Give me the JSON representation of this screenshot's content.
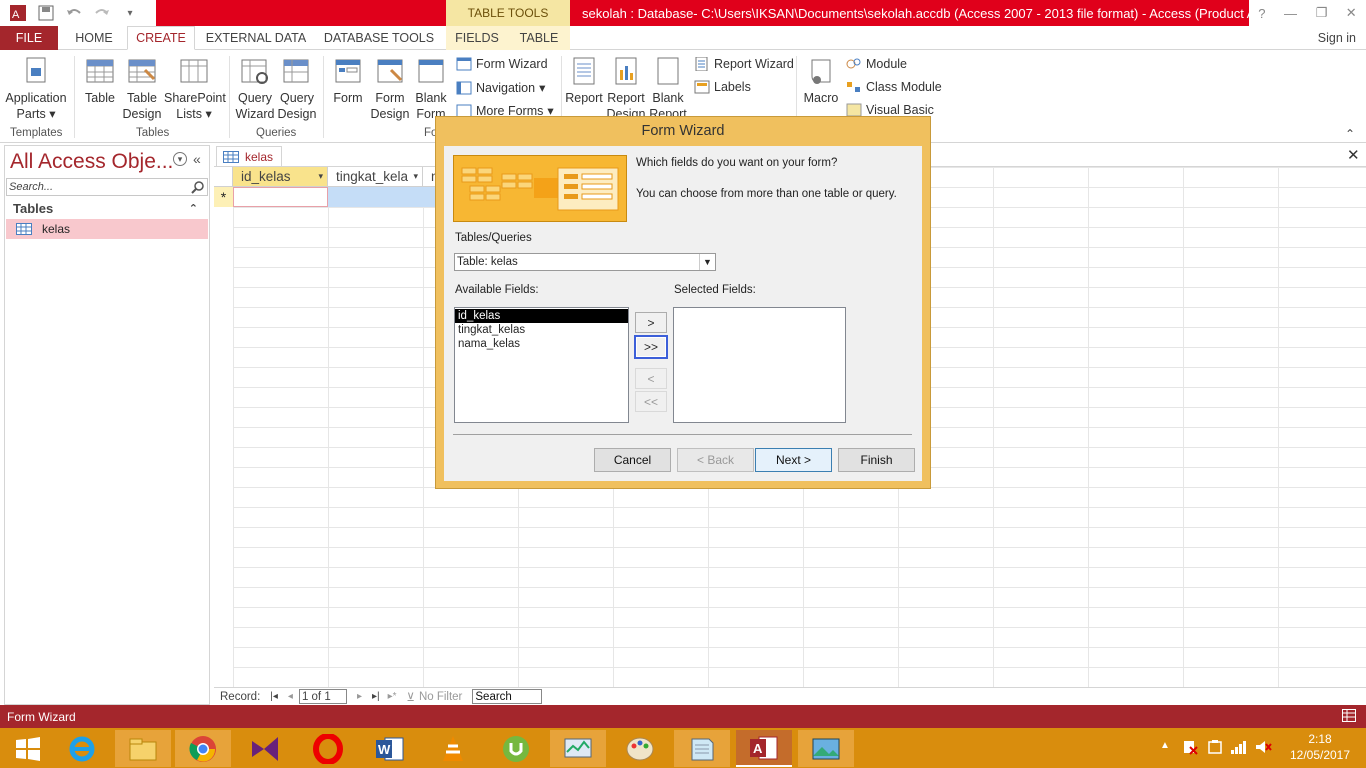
{
  "window": {
    "title": "sekolah : Database- C:\\Users\\IKSAN\\Documents\\sekolah.accdb (Access 2007 - 2013 file format) - Access (Product Activati...",
    "contextual_group": "TABLE TOOLS",
    "help": "?"
  },
  "ribbon_tabs": [
    "FILE",
    "HOME",
    "CREATE",
    "EXTERNAL DATA",
    "DATABASE TOOLS",
    "FIELDS",
    "TABLE"
  ],
  "signin": "Sign in",
  "ribbon": {
    "templates": {
      "label": "Templates",
      "app_parts": "Application",
      "app_parts2": "Parts"
    },
    "tables": {
      "label": "Tables",
      "table": "Table",
      "table_design1": "Table",
      "table_design2": "Design",
      "sharepoint1": "SharePoint",
      "sharepoint2": "Lists"
    },
    "queries": {
      "label": "Queries",
      "wizard1": "Query",
      "wizard2": "Wizard",
      "design1": "Query",
      "design2": "Design"
    },
    "forms": {
      "label": "Fo",
      "form": "Form",
      "form_design1": "Form",
      "form_design2": "Design",
      "blank1": "Blank",
      "blank2": "Form",
      "wizard": "Form Wizard",
      "navigation": "Navigation",
      "more": "More Forms"
    },
    "reports": {
      "report": "Report",
      "design1": "Report",
      "design2": "Design",
      "blank1": "Blank",
      "blank2": "Report",
      "wizard": "Report Wizard",
      "labels": "Labels"
    },
    "macros": {
      "macro": "Macro",
      "module": "Module",
      "class_module": "Class Module",
      "visual_basic": "Visual Basic"
    }
  },
  "nav": {
    "title": "All Access Obje...",
    "search_placeholder": "Search...",
    "group": "Tables",
    "items": [
      "kelas"
    ]
  },
  "document": {
    "tab": "kelas",
    "columns": [
      "id_kelas",
      "tingkat_kela",
      "na"
    ],
    "new_row_marker": "*"
  },
  "record_bar": {
    "label": "Record:",
    "position": "1 of 1",
    "filter": "No Filter",
    "search": "Search"
  },
  "status": "Form Wizard",
  "clock": {
    "time": "2:18",
    "date": "12/05/2017"
  },
  "dialog": {
    "title": "Form Wizard",
    "question": "Which fields do you want on your form?",
    "hint": "You can choose from more than one table or query.",
    "tables_label": "Tables/Queries",
    "table_value": "Table: kelas",
    "available_label": "Available Fields:",
    "selected_label": "Selected Fields:",
    "available_fields": [
      "id_kelas",
      "tingkat_kelas",
      "nama_kelas"
    ],
    "move_one": ">",
    "move_all": ">>",
    "remove_one": "<",
    "remove_all": "<<",
    "cancel": "Cancel",
    "back": "< Back",
    "next": "Next >",
    "finish": "Finish"
  },
  "colors": {
    "access_red": "#a4262c",
    "title_red": "#e0001b",
    "taskbar": "#d98d0d",
    "dialog_frame": "#f0c05e"
  }
}
